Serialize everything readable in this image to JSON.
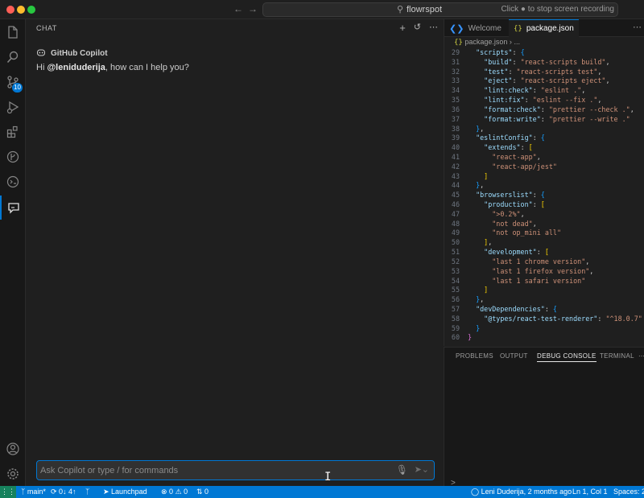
{
  "titlebar": {
    "title": "flowrspot",
    "back_icon": "arrow-left-icon",
    "forward_icon": "arrow-right-icon",
    "recording_hint": "Click ● to stop screen recording"
  },
  "activity_bar": {
    "items": [
      {
        "name": "explorer",
        "icon": "files-icon"
      },
      {
        "name": "search",
        "icon": "search-icon"
      },
      {
        "name": "source-control",
        "icon": "source-control-icon",
        "badge": "10"
      },
      {
        "name": "run-debug",
        "icon": "run-debug-icon"
      },
      {
        "name": "extensions",
        "icon": "extensions-icon"
      },
      {
        "name": "gitlens",
        "icon": "git-graph-icon"
      },
      {
        "name": "remote",
        "icon": "remote-explorer-icon"
      },
      {
        "name": "chat",
        "icon": "chat-icon",
        "active": true
      }
    ],
    "bottom": [
      {
        "name": "accounts",
        "icon": "account-icon"
      },
      {
        "name": "manage",
        "icon": "gear-icon"
      }
    ]
  },
  "chat": {
    "header": "CHAT",
    "assistant_name": "GitHub Copilot",
    "greeting_prefix": "Hi ",
    "greeting_user": "@leniduderija",
    "greeting_suffix": ", how can I help you?",
    "input_placeholder": "Ask Copilot or type / for commands"
  },
  "editor": {
    "tabs": [
      {
        "label": "Welcome",
        "icon": "vscode-icon"
      },
      {
        "label": "package.json",
        "icon": "json-icon",
        "active": true
      }
    ],
    "breadcrumb": {
      "file": "package.json",
      "rest": "..."
    },
    "lines": [
      {
        "n": "29",
        "tokens": [
          [
            "p",
            "  "
          ],
          [
            "k",
            "\"scripts\""
          ],
          [
            "p",
            ": "
          ],
          [
            "b2",
            "{"
          ]
        ]
      },
      {
        "n": "31",
        "tokens": [
          [
            "p",
            "    "
          ],
          [
            "k",
            "\"build\""
          ],
          [
            "p",
            ": "
          ],
          [
            "s",
            "\"react-scripts build\""
          ],
          [
            "p",
            ","
          ]
        ]
      },
      {
        "n": "32",
        "tokens": [
          [
            "p",
            "    "
          ],
          [
            "k",
            "\"test\""
          ],
          [
            "p",
            ": "
          ],
          [
            "s",
            "\"react-scripts test\""
          ],
          [
            "p",
            ","
          ]
        ]
      },
      {
        "n": "33",
        "tokens": [
          [
            "p",
            "    "
          ],
          [
            "k",
            "\"eject\""
          ],
          [
            "p",
            ": "
          ],
          [
            "s",
            "\"react-scripts eject\""
          ],
          [
            "p",
            ","
          ]
        ]
      },
      {
        "n": "34",
        "tokens": [
          [
            "p",
            "    "
          ],
          [
            "k",
            "\"lint:check\""
          ],
          [
            "p",
            ": "
          ],
          [
            "s",
            "\"eslint .\""
          ],
          [
            "p",
            ","
          ]
        ]
      },
      {
        "n": "35",
        "tokens": [
          [
            "p",
            "    "
          ],
          [
            "k",
            "\"lint:fix\""
          ],
          [
            "p",
            ": "
          ],
          [
            "s",
            "\"eslint --fix .\""
          ],
          [
            "p",
            ","
          ]
        ]
      },
      {
        "n": "36",
        "tokens": [
          [
            "p",
            "    "
          ],
          [
            "k",
            "\"format:check\""
          ],
          [
            "p",
            ": "
          ],
          [
            "s",
            "\"prettier --check .\""
          ],
          [
            "p",
            ","
          ]
        ]
      },
      {
        "n": "37",
        "tokens": [
          [
            "p",
            "    "
          ],
          [
            "k",
            "\"format:write\""
          ],
          [
            "p",
            ": "
          ],
          [
            "s",
            "\"prettier --write .\""
          ]
        ]
      },
      {
        "n": "38",
        "tokens": [
          [
            "p",
            "  "
          ],
          [
            "b2",
            "}"
          ],
          [
            "p",
            ","
          ]
        ]
      },
      {
        "n": "39",
        "tokens": [
          [
            "p",
            "  "
          ],
          [
            "k",
            "\"eslintConfig\""
          ],
          [
            "p",
            ": "
          ],
          [
            "b2",
            "{"
          ]
        ]
      },
      {
        "n": "40",
        "tokens": [
          [
            "p",
            "    "
          ],
          [
            "k",
            "\"extends\""
          ],
          [
            "p",
            ": "
          ],
          [
            "b3",
            "["
          ]
        ]
      },
      {
        "n": "41",
        "tokens": [
          [
            "p",
            "      "
          ],
          [
            "s",
            "\"react-app\""
          ],
          [
            "p",
            ","
          ]
        ]
      },
      {
        "n": "42",
        "tokens": [
          [
            "p",
            "      "
          ],
          [
            "s",
            "\"react-app/jest\""
          ]
        ]
      },
      {
        "n": "43",
        "tokens": [
          [
            "p",
            "    "
          ],
          [
            "b3",
            "]"
          ]
        ]
      },
      {
        "n": "44",
        "tokens": [
          [
            "p",
            "  "
          ],
          [
            "b2",
            "}"
          ],
          [
            "p",
            ","
          ]
        ]
      },
      {
        "n": "45",
        "tokens": [
          [
            "p",
            "  "
          ],
          [
            "k",
            "\"browserslist\""
          ],
          [
            "p",
            ": "
          ],
          [
            "b2",
            "{"
          ]
        ]
      },
      {
        "n": "46",
        "tokens": [
          [
            "p",
            "    "
          ],
          [
            "k",
            "\"production\""
          ],
          [
            "p",
            ": "
          ],
          [
            "b3",
            "["
          ]
        ]
      },
      {
        "n": "47",
        "tokens": [
          [
            "p",
            "      "
          ],
          [
            "s",
            "\">0.2%\""
          ],
          [
            "p",
            ","
          ]
        ]
      },
      {
        "n": "48",
        "tokens": [
          [
            "p",
            "      "
          ],
          [
            "s",
            "\"not dead\""
          ],
          [
            "p",
            ","
          ]
        ]
      },
      {
        "n": "49",
        "tokens": [
          [
            "p",
            "      "
          ],
          [
            "s",
            "\"not op_mini all\""
          ]
        ]
      },
      {
        "n": "50",
        "tokens": [
          [
            "p",
            "    "
          ],
          [
            "b3",
            "]"
          ],
          [
            "p",
            ","
          ]
        ]
      },
      {
        "n": "51",
        "tokens": [
          [
            "p",
            "    "
          ],
          [
            "k",
            "\"development\""
          ],
          [
            "p",
            ": "
          ],
          [
            "b3",
            "["
          ]
        ]
      },
      {
        "n": "52",
        "tokens": [
          [
            "p",
            "      "
          ],
          [
            "s",
            "\"last 1 chrome version\""
          ],
          [
            "p",
            ","
          ]
        ]
      },
      {
        "n": "53",
        "tokens": [
          [
            "p",
            "      "
          ],
          [
            "s",
            "\"last 1 firefox version\""
          ],
          [
            "p",
            ","
          ]
        ]
      },
      {
        "n": "54",
        "tokens": [
          [
            "p",
            "      "
          ],
          [
            "s",
            "\"last 1 safari version\""
          ]
        ]
      },
      {
        "n": "55",
        "tokens": [
          [
            "p",
            "    "
          ],
          [
            "b3",
            "]"
          ]
        ]
      },
      {
        "n": "56",
        "tokens": [
          [
            "p",
            "  "
          ],
          [
            "b2",
            "}"
          ],
          [
            "p",
            ","
          ]
        ]
      },
      {
        "n": "57",
        "tokens": [
          [
            "p",
            "  "
          ],
          [
            "k",
            "\"devDependencies\""
          ],
          [
            "p",
            ": "
          ],
          [
            "b2",
            "{"
          ]
        ]
      },
      {
        "n": "58",
        "tokens": [
          [
            "p",
            "    "
          ],
          [
            "k",
            "\"@types/react-test-renderer\""
          ],
          [
            "p",
            ": "
          ],
          [
            "s",
            "\"^18.0.7\""
          ]
        ]
      },
      {
        "n": "59",
        "tokens": [
          [
            "p",
            "  "
          ],
          [
            "b2",
            "}"
          ]
        ]
      },
      {
        "n": "60",
        "tokens": [
          [
            "b1",
            "}"
          ]
        ]
      }
    ]
  },
  "panel": {
    "tabs": [
      "PROBLEMS",
      "OUTPUT",
      "DEBUG CONSOLE",
      "TERMINAL"
    ],
    "active_tab": "DEBUG CONSOLE",
    "prompt": ">"
  },
  "statusbar": {
    "branch": "main*",
    "sync": "0↓ 4↑",
    "launchpad": "Launchpad",
    "errors": "0",
    "warnings": "0",
    "ports": "0",
    "blame": "Leni Duderija, 2 months ago",
    "position": "Ln 1, Col 1",
    "spaces": "Spaces: 2"
  },
  "colors": {
    "accent": "#0078d4",
    "status_bar": "#0078d4",
    "remote_indicator": "#16825d",
    "background": "#1f1f1f"
  }
}
